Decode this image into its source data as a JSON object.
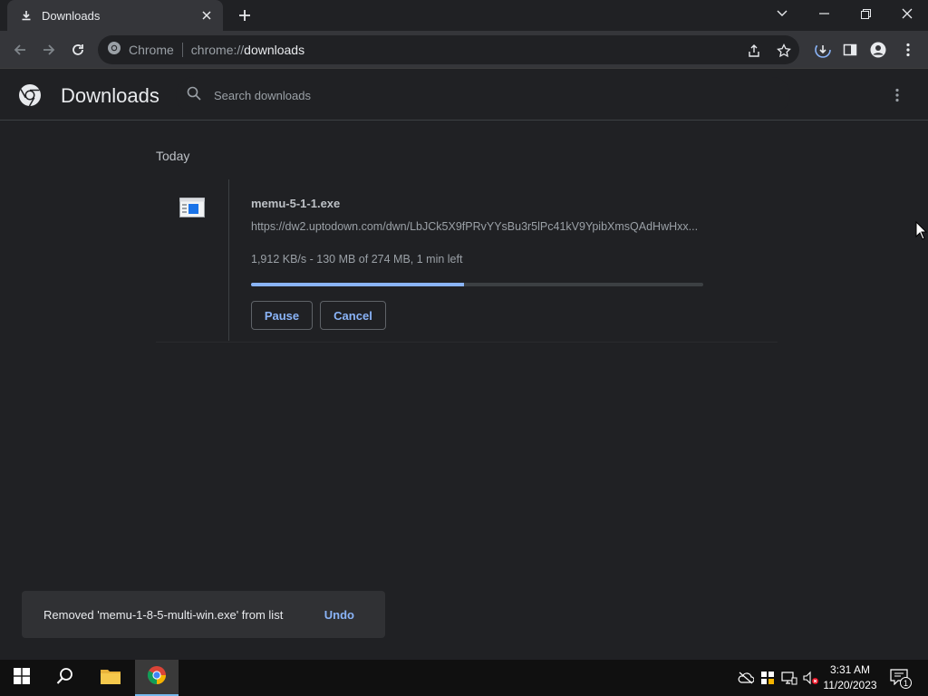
{
  "browser": {
    "tab": {
      "title": "Downloads",
      "icon": "download-icon"
    },
    "omnibox": {
      "site_label": "Chrome",
      "url_prefix": "chrome://",
      "url_host": "downloads"
    }
  },
  "downloads_page": {
    "title": "Downloads",
    "search_placeholder": "Search downloads",
    "date_section": "Today",
    "items": [
      {
        "file_name": "memu-5-1-1.exe",
        "url": "https://dw2.uptodown.com/dwn/LbJCk5X9fPRvYYsBu3r5lPc41kV9YpibXmsQAdHwHxx...",
        "status": "1,912 KB/s - 130 MB of 274 MB, 1 min left",
        "progress": 0.47,
        "pause_label": "Pause",
        "cancel_label": "Cancel"
      }
    ]
  },
  "toast": {
    "message": "Removed 'memu-1-8-5-multi-win.exe' from list",
    "undo_label": "Undo"
  },
  "taskbar": {
    "time": "3:31 AM",
    "date": "11/20/2023",
    "notification_count": "1"
  },
  "colors": {
    "accent": "#8ab4f8",
    "background": "#202124",
    "toolbar": "#35363a"
  }
}
